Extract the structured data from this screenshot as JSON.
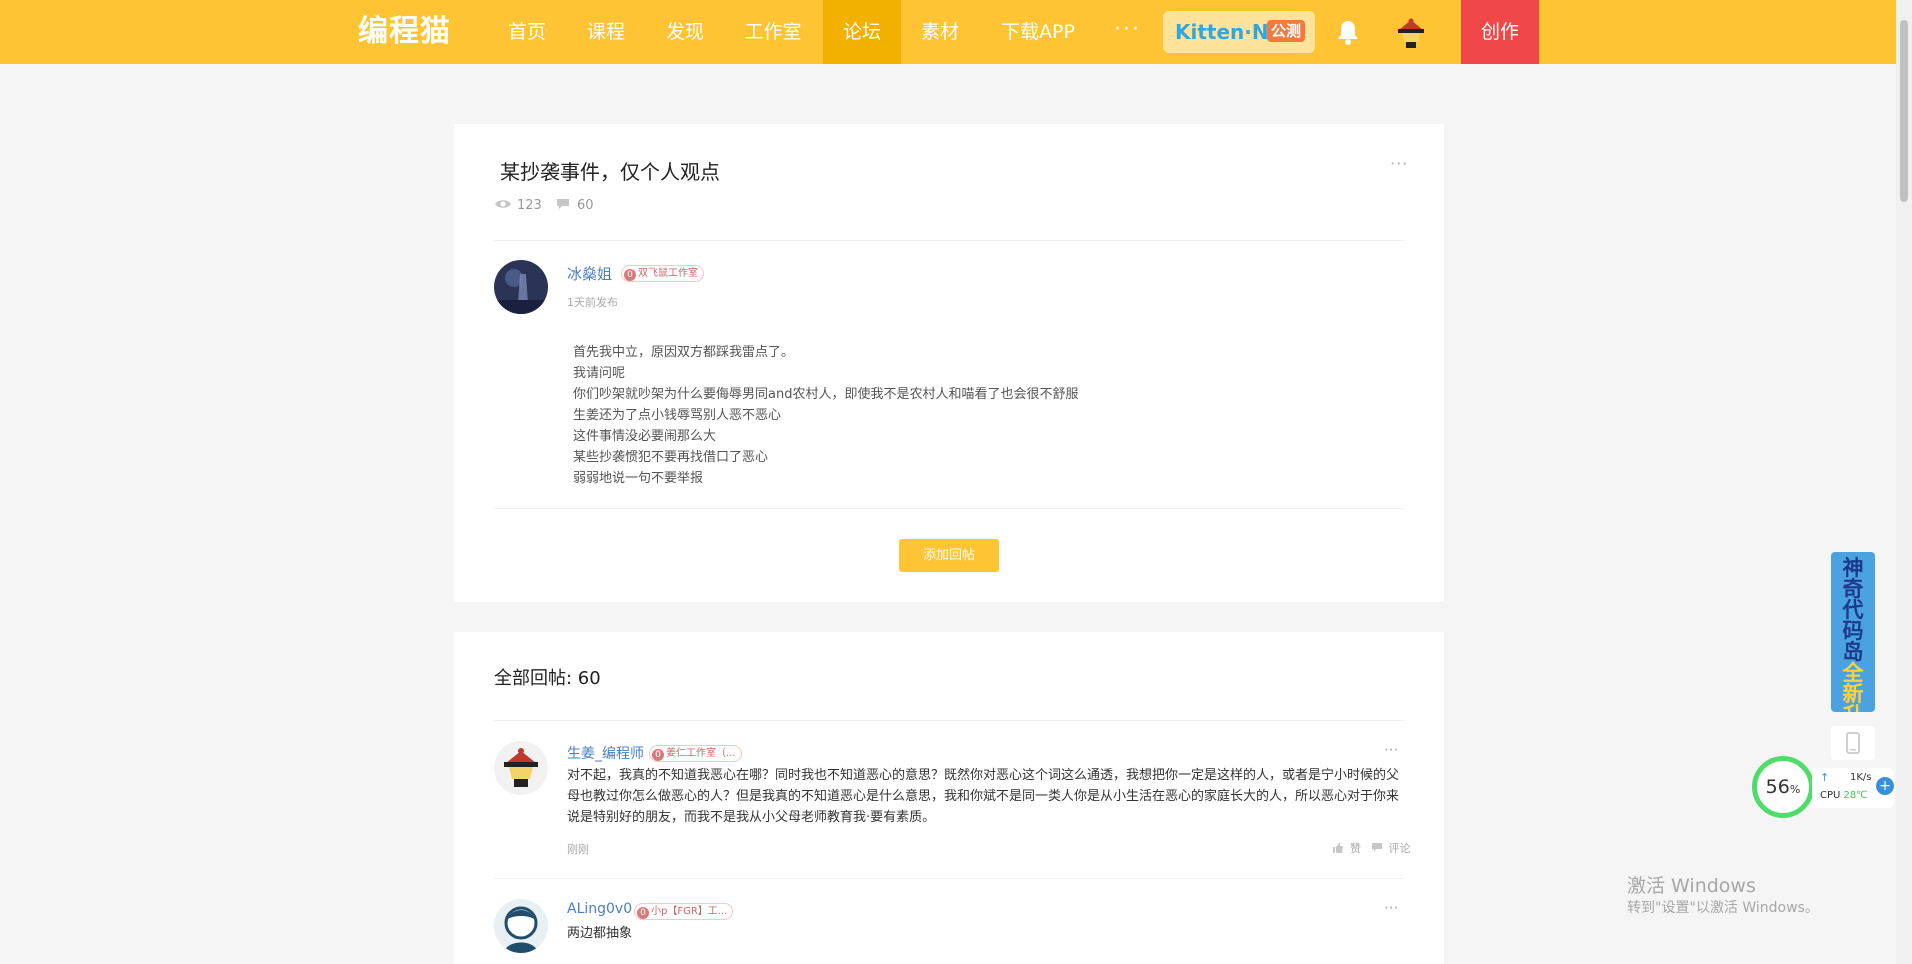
{
  "nav": {
    "logo": "编程猫",
    "items": [
      {
        "label": "首页"
      },
      {
        "label": "课程"
      },
      {
        "label": "发现"
      },
      {
        "label": "工作室"
      },
      {
        "label": "论坛"
      },
      {
        "label": "素材"
      },
      {
        "label": "下载APP"
      }
    ],
    "more": "···",
    "kitten_name": "Kitten·N",
    "kitten_beta": "公测",
    "create_label": "创作",
    "accent_color": "#fec433",
    "create_color": "#f04848"
  },
  "post": {
    "title": "某抄袭事件，仅个人观点",
    "views": "123",
    "comments": "60",
    "more": "···",
    "author": {
      "name": "冰燊姐",
      "level": "0",
      "studio": "双飞鼠工作室"
    },
    "time": "1天前发布",
    "body": [
      "首先我中立，原因双方都踩我雷点了。",
      "我请问呢",
      "你们吵架就吵架为什么要侮辱男同and农村人，即使我不是农村人和喵看了也会很不舒服",
      "生姜还为了点小钱辱骂别人恶不恶心",
      "这件事情没必要闹那么大",
      "某些抄袭惯犯不要再找借口了恶心",
      "弱弱地说一句不要举报"
    ],
    "reply_button": "添加回帖"
  },
  "replies": {
    "title_label": "全部回帖: ",
    "count": "60",
    "items": [
      {
        "name": "生姜_编程师",
        "level": "0",
        "studio": "姜仁工作室（...",
        "text": "对不起，我真的不知道我恶心在哪？同时我也不知道恶心的意思？既然你对恶心这个词这么通透，我想把你一定是这样的人，或者是宁小时候的父母也教过你怎么做恶心的人？但是我真的不知道恶心是什么意思，我和你斌不是同一类人你是从小生活在恶心的家庭长大的人，所以恶心对于你来说是特别好的朋友，而我不是我从小父母老师教育我·要有素质。",
        "time": "刚刚",
        "like": "赞",
        "comment": "评论"
      },
      {
        "name": "ALing0v0",
        "level": "0",
        "studio": "小p【FGR】工...",
        "text": "两边都抽象"
      }
    ]
  },
  "side": {
    "banner_text_a": "神奇代码岛",
    "banner_text_b": "全新升级"
  },
  "cpu_widget": {
    "percent": "56",
    "percent_unit": "%",
    "speed": "1K/s",
    "up_arrow": "↑",
    "label": "CPU",
    "temp": "28℃",
    "plus": "+"
  },
  "watermark": {
    "title": "激活 Windows",
    "subtitle": "转到\"设置\"以激活 Windows。"
  }
}
